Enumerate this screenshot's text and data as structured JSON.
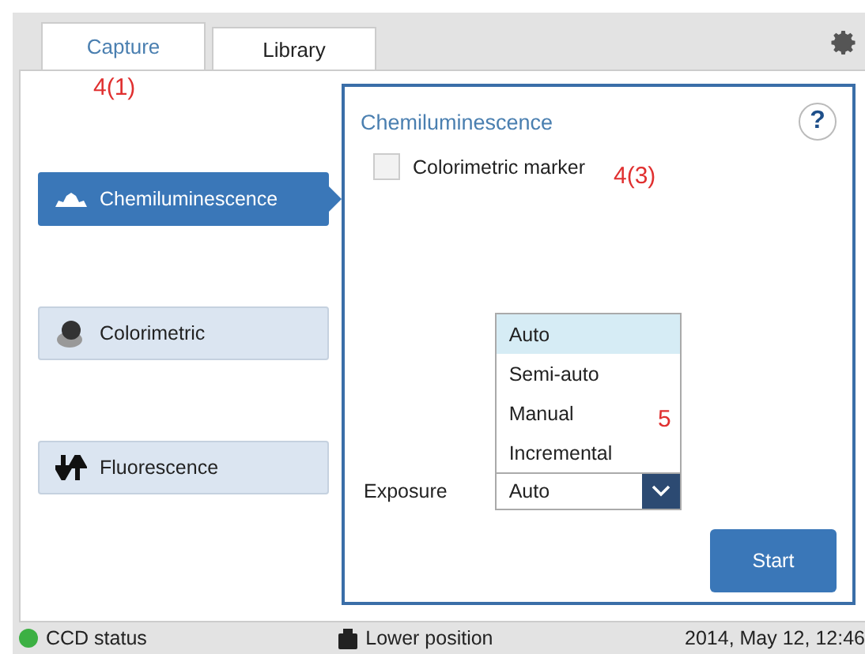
{
  "tabs": [
    {
      "label": "Capture",
      "selected": true
    },
    {
      "label": "Library",
      "selected": false
    }
  ],
  "modes": [
    {
      "label": "Chemiluminescence",
      "selected": true
    },
    {
      "label": "Colorimetric",
      "selected": false
    },
    {
      "label": "Fluorescence",
      "selected": false
    }
  ],
  "panel": {
    "title": "Chemiluminescence",
    "help": "?",
    "marker": {
      "label": "Colorimetric marker",
      "checked": false
    },
    "exposure": {
      "label": "Exposure",
      "value": "Auto",
      "options": [
        {
          "label": "Auto",
          "selected": true
        },
        {
          "label": "Semi-auto",
          "selected": false
        },
        {
          "label": "Manual",
          "selected": false
        },
        {
          "label": "Incremental",
          "selected": false
        }
      ]
    },
    "start": "Start"
  },
  "callouts": [
    "4(1)",
    "4(3)",
    "5"
  ],
  "status_bar": {
    "ccd": {
      "label": "CCD status",
      "color": "#3cb043"
    },
    "position": "Lower position",
    "datetime": "2014, May 12, 12:46"
  }
}
